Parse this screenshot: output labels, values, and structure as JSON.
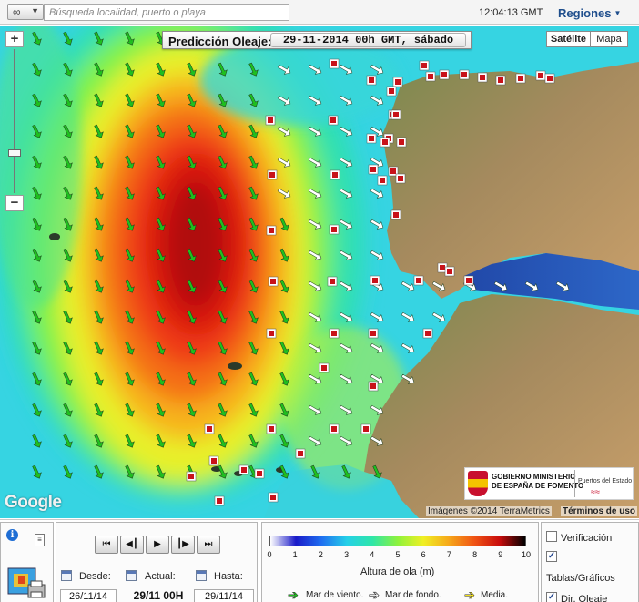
{
  "topbar": {
    "search_placeholder": "Búsqueda localidad, puerto o playa",
    "clock": "12:04:13 GMT",
    "regions_label": "Regiones"
  },
  "map": {
    "title_label": "Predicción Oleaje:",
    "date_label": "29-11-2014 00h GMT, sábado",
    "maptype_satellite": "Satélite",
    "maptype_map": "Mapa",
    "zoom_in": "+",
    "zoom_out": "−",
    "google": "Google",
    "attribution": "Imágenes ©2014 TerraMetrics",
    "terms": "Términos de uso",
    "gov_text": "GOBIERNO  MINISTERIO\nDE ESPAÑA  DE FOMENTO",
    "puertos_text": "Puertos del Estado"
  },
  "time_controls": {
    "from_label": "Desde:",
    "from_value": "26/11/14",
    "current_label": "Actual:",
    "current_value": "29/11 00H",
    "to_label": "Hasta:",
    "to_value": "29/11/14"
  },
  "legend": {
    "ticks": [
      "0",
      "1",
      "2",
      "3",
      "4",
      "5",
      "6",
      "7",
      "8",
      "9",
      "10"
    ],
    "unit_label": "Altura de ola (m)",
    "wind_label": "Mar de viento.",
    "swell_label": "Mar de fondo.",
    "mean_label": "Media.",
    "colors": {
      "wind_arrow": "#1fbf1f",
      "swell_arrow": "#ffffff",
      "mean_arrow": "#f3e11b"
    },
    "scale_colors": [
      "#ffffff",
      "#1a1ac8",
      "#1f6ef0",
      "#25d0e8",
      "#2ee6a8",
      "#8ef23c",
      "#f0f024",
      "#f6a81a",
      "#f05414",
      "#c80c0c",
      "#000000"
    ]
  },
  "options": {
    "verification_label": "Verificación",
    "verification_checked": false,
    "tables_label": "Tablas/Gráficos",
    "tables_checked": true,
    "direction_label": "Dir. Oleaje",
    "direction_checked": true
  }
}
